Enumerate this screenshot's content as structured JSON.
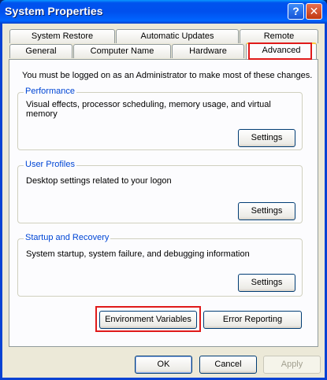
{
  "window": {
    "title": "System Properties",
    "help_glyph": "?",
    "close_glyph": "✕"
  },
  "tabs_back": [
    {
      "label": "System Restore"
    },
    {
      "label": "Automatic Updates"
    },
    {
      "label": "Remote"
    }
  ],
  "tabs_front": [
    {
      "label": "General"
    },
    {
      "label": "Computer Name"
    },
    {
      "label": "Hardware"
    },
    {
      "label": "Advanced",
      "active": true
    }
  ],
  "advanced": {
    "admin_note": "You must be logged on as an Administrator to make most of these changes.",
    "performance": {
      "title": "Performance",
      "description": "Visual effects, processor scheduling, memory usage, and virtual memory",
      "button": "Settings"
    },
    "user_profiles": {
      "title": "User Profiles",
      "description": "Desktop settings related to your logon",
      "button": "Settings"
    },
    "startup_recovery": {
      "title": "Startup and Recovery",
      "description": "System startup, system failure, and debugging information",
      "button": "Settings"
    },
    "environment_variables": "Environment Variables",
    "error_reporting": "Error Reporting"
  },
  "footer": {
    "ok": "OK",
    "cancel": "Cancel",
    "apply": "Apply"
  },
  "colors": {
    "highlight": "#E01A1A",
    "group_title": "#0046D5",
    "title_bar": "#0053EE"
  }
}
